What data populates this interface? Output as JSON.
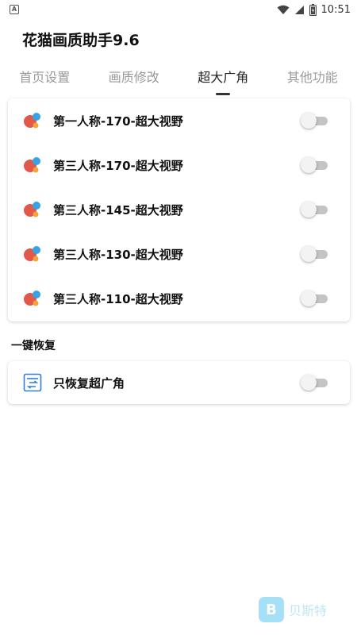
{
  "status_bar": {
    "time": "10:51",
    "notification_letter": "A"
  },
  "app": {
    "title": "花猫画质助手9.6"
  },
  "tabs": [
    {
      "label": "首页设置",
      "active": false
    },
    {
      "label": "画质修改",
      "active": false
    },
    {
      "label": "超大广角",
      "active": true
    },
    {
      "label": "其他功能",
      "active": false
    }
  ],
  "wide_angle_items": [
    {
      "label": "第一人称-170-超大视野",
      "enabled": false
    },
    {
      "label": "第三人称-170-超大视野",
      "enabled": false
    },
    {
      "label": "第三人称-145-超大视野",
      "enabled": false
    },
    {
      "label": "第三人称-130-超大视野",
      "enabled": false
    },
    {
      "label": "第三人称-110-超大视野",
      "enabled": false
    }
  ],
  "restore_section": {
    "title": "一键恢复",
    "item": {
      "label": "只恢复超广角",
      "enabled": false
    }
  },
  "watermark": {
    "text": "贝斯特"
  },
  "colors": {
    "accent_red": "#e2584a",
    "accent_blue": "#36a3e8",
    "toggle_off": "#c4c4c4",
    "restore_icon": "#2f7ed8"
  }
}
